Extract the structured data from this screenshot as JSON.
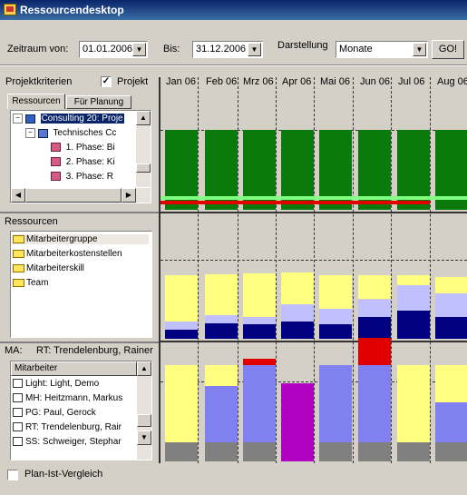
{
  "window": {
    "title": "Ressourcendesktop",
    "icon": "app-icon"
  },
  "toolbar": {
    "zeitraum_label": "Zeitraum von:",
    "zeitraum_value": "01.01.2006",
    "bis_label": "Bis:",
    "bis_value": "31.12.2006",
    "darstellung_label": "Darstellung",
    "darstellung_value": "Monate",
    "go_label": "GO!"
  },
  "header": {
    "projektkriterien_label": "Projektkriterien",
    "projekt_checkbox_label": "Projekt",
    "projekt_checked": true,
    "months": [
      "Jan 06",
      "Feb 06",
      "Mrz 06",
      "Apr 06",
      "Mai 06",
      "Jun 06",
      "Jul 06",
      "Aug 06"
    ]
  },
  "tabs": [
    {
      "label": "Ressourcen"
    },
    {
      "label": "Für Planung"
    }
  ],
  "project_tree": [
    {
      "label": "Consulting 20: Proje",
      "level": 0,
      "icon": "consulting-icon"
    },
    {
      "label": "Technisches Cc",
      "level": 1,
      "icon": "technical-icon"
    },
    {
      "label": "1. Phase: Bi",
      "level": 2,
      "icon": "phase-icon"
    },
    {
      "label": "2. Phase: Ki",
      "level": 2,
      "icon": "phase-icon"
    },
    {
      "label": "3. Phase: R",
      "level": 2,
      "icon": "phase-icon"
    }
  ],
  "ressourcen": {
    "label": "Ressourcen",
    "items": [
      "Mitarbeitergruppe",
      "Mitarbeiterkostenstellen",
      "Mitarbeiterskill",
      "Team"
    ]
  },
  "ma": {
    "label": "MA:",
    "selected": "RT: Trendelenburg, Rainer",
    "column_header": "Mitarbeiter",
    "items": [
      "Light: Light, Demo",
      "MH: Heitzmann, Markus",
      "PG: Paul, Gerock",
      "RT: Trendelenburg, Rair",
      "SS: Schweiger, Stephar"
    ]
  },
  "footer": {
    "plan_ist_label": "Plan-Ist-Vergleich",
    "plan_ist_checked": false
  },
  "colors": {
    "green": "#0a7a0a",
    "light_green": "#80ff80",
    "red": "#e00000",
    "yellow": "#ffff80",
    "lavender": "#c0c0ff",
    "navy": "#000080",
    "periwinkle": "#8080f0",
    "gray": "#808080",
    "purple": "#b000c0"
  },
  "chart_data": [
    {
      "type": "bar",
      "name": "project-chart",
      "categories": [
        "Jan 06",
        "Feb 06",
        "Mrz 06",
        "Apr 06",
        "Mai 06",
        "Jun 06",
        "Jul 06",
        "Aug 06"
      ],
      "series": [
        {
          "values": [
            1,
            1,
            1,
            1,
            1,
            1,
            1,
            1
          ]
        }
      ]
    },
    {
      "type": "bar",
      "name": "ressourcen-chart",
      "stacked": true,
      "categories": [
        "Jan 06",
        "Feb 06",
        "Mrz 06",
        "Apr 06",
        "Mai 06",
        "Jun 06",
        "Jul 06",
        "Aug 06"
      ],
      "series": [
        {
          "color": "navy",
          "values": [
            0.12,
            0.2,
            0.18,
            0.22,
            0.18,
            0.28,
            0.36,
            0.28
          ]
        },
        {
          "color": "lavender",
          "values": [
            0.1,
            0.1,
            0.1,
            0.22,
            0.2,
            0.22,
            0.32,
            0.3
          ]
        },
        {
          "color": "yellow",
          "values": [
            0.58,
            0.52,
            0.55,
            0.4,
            0.42,
            0.3,
            0.12,
            0.2
          ]
        }
      ]
    },
    {
      "type": "bar",
      "name": "ma-chart",
      "stacked": true,
      "categories": [
        "Jan 06",
        "Feb 06",
        "Mrz 06",
        "Apr 06",
        "Mai 06",
        "Jun 06",
        "Jul 06",
        "Aug 06"
      ],
      "series": [
        {
          "color": "gray",
          "values": [
            0.24,
            0.24,
            0.24,
            0,
            0.24,
            0.24,
            0.24,
            0.24
          ]
        },
        {
          "color": "periwinkle",
          "values": [
            0,
            0.7,
            0.96,
            0,
            0.96,
            0.96,
            0,
            0.5
          ]
        },
        {
          "color": "purple",
          "values": [
            0,
            0,
            0,
            0.98,
            0,
            0,
            0,
            0
          ]
        },
        {
          "color": "yellow",
          "values": [
            0.96,
            0.26,
            0,
            0,
            0,
            0,
            0.96,
            0.46
          ]
        },
        {
          "color": "red",
          "values": [
            0,
            0,
            0.08,
            0,
            0,
            0.34,
            0,
            0
          ]
        }
      ]
    }
  ]
}
